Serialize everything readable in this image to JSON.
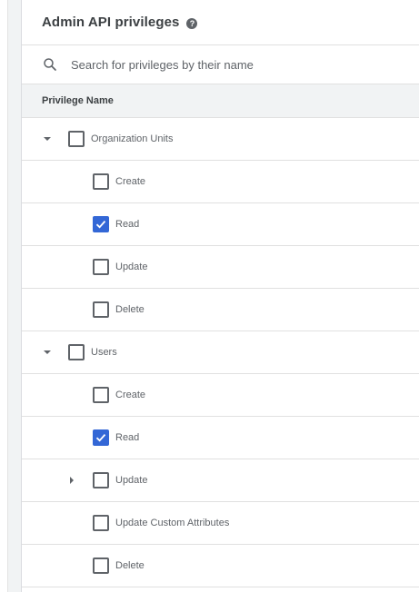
{
  "header": {
    "title": "Admin API privileges",
    "help_glyph": "?"
  },
  "search": {
    "placeholder": "Search for privileges by their name",
    "value": ""
  },
  "table": {
    "column_header": "Privilege Name"
  },
  "groups": [
    {
      "label": "Organization Units",
      "expanded": true,
      "checked": false,
      "children": [
        {
          "label": "Create",
          "checked": false
        },
        {
          "label": "Read",
          "checked": true
        },
        {
          "label": "Update",
          "checked": false
        },
        {
          "label": "Delete",
          "checked": false
        }
      ]
    },
    {
      "label": "Users",
      "expanded": true,
      "checked": false,
      "children": [
        {
          "label": "Create",
          "checked": false
        },
        {
          "label": "Read",
          "checked": true
        },
        {
          "label": "Update",
          "checked": false,
          "expandable": true,
          "expanded": false
        },
        {
          "label": "Update Custom Attributes",
          "checked": false
        },
        {
          "label": "Delete",
          "checked": false
        }
      ]
    }
  ],
  "colors": {
    "checked": "#3367d6",
    "border": "#e0e0e0",
    "header_bg": "#f1f3f4"
  }
}
